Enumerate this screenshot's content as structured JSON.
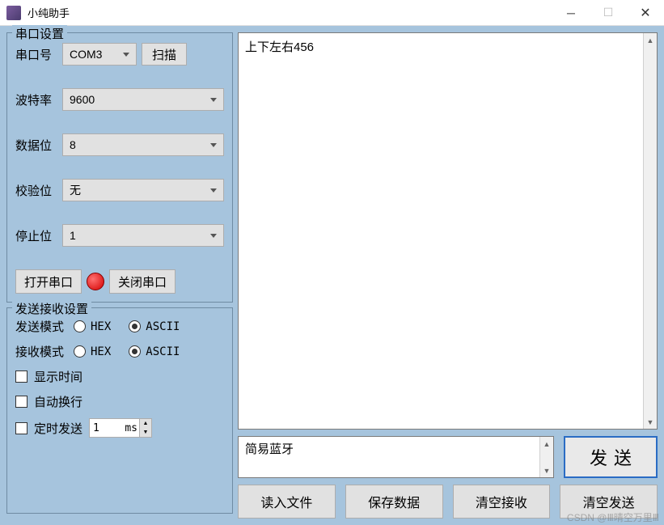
{
  "window": {
    "title": "小纯助手"
  },
  "serial_settings": {
    "group_title": "串口设置",
    "port_label": "串口号",
    "port_value": "COM3",
    "scan_label": "扫描",
    "baud_label": "波特率",
    "baud_value": "9600",
    "data_bits_label": "数据位",
    "data_bits_value": "8",
    "parity_label": "校验位",
    "parity_value": "无",
    "stop_bits_label": "停止位",
    "stop_bits_value": "1",
    "open_label": "打开串口",
    "close_label": "关闭串口"
  },
  "txrx_settings": {
    "group_title": "发送接收设置",
    "tx_mode_label": "发送模式",
    "rx_mode_label": "接收模式",
    "hex_label": "HEX",
    "ascii_label": "ASCII",
    "tx_mode": "ASCII",
    "rx_mode": "ASCII",
    "show_time_label": "显示时间",
    "show_time_checked": false,
    "auto_wrap_label": "自动换行",
    "auto_wrap_checked": false,
    "timed_send_label": "定时发送",
    "timed_send_checked": false,
    "timed_send_value": "1",
    "timed_send_unit": "ms"
  },
  "receive": {
    "content": "上下左右456"
  },
  "send": {
    "content": "简易蓝牙",
    "button_label": "发送"
  },
  "bottom": {
    "read_file": "读入文件",
    "save_data": "保存数据",
    "clear_recv": "清空接收",
    "clear_send": "清空发送"
  },
  "watermark": "CSDN @Ⅲ晴空万里Ⅲ"
}
